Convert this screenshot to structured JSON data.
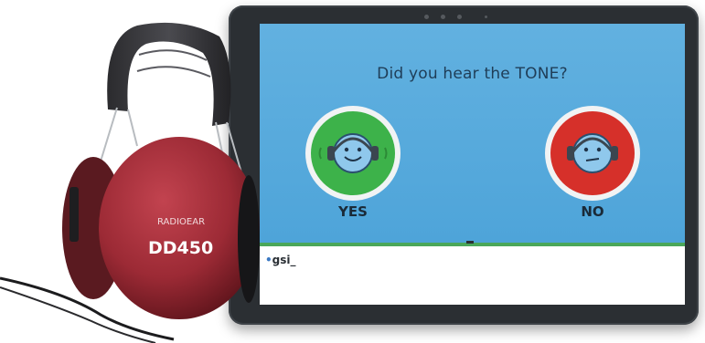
{
  "question": "Did you hear the TONE?",
  "answers": {
    "yes_label": "YES",
    "no_label": "NO"
  },
  "brand": {
    "logo_text": "gsi_",
    "headphone_brand": "RADIOEAR",
    "headphone_model": "DD450"
  },
  "icons": {
    "yes": "happy-face-headphones-icon",
    "no": "neutral-face-headphones-icon"
  },
  "colors": {
    "screen_blue": "#4ea4d9",
    "yes_green": "#3db24a",
    "no_red": "#d6302a",
    "headphone_red": "#9c2a35"
  }
}
